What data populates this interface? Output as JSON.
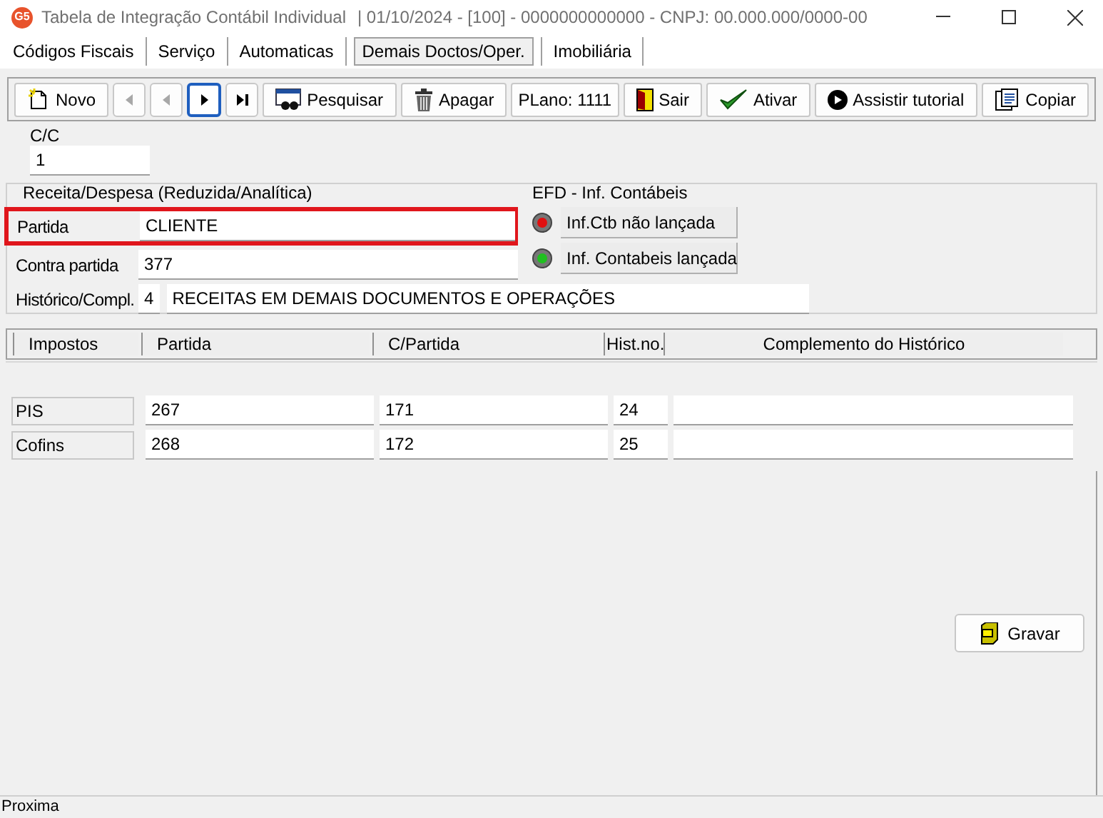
{
  "window": {
    "app_badge": "G5",
    "title": "Tabela de Integração Contábil Individual",
    "subtitle": "|  01/10/2024 - [100] - 0000000000000 - CNPJ: 00.000.000/0000-00"
  },
  "tabs": [
    {
      "label": "Códigos Fiscais",
      "selected": false
    },
    {
      "label": "Serviço",
      "selected": false
    },
    {
      "label": "Automaticas",
      "selected": false
    },
    {
      "label": "Demais Doctos/Oper.",
      "selected": true
    },
    {
      "label": "Imobiliária",
      "selected": false
    }
  ],
  "toolbar": [
    {
      "kind": "button",
      "label": "Novo"
    },
    {
      "kind": "nav",
      "disabled": true,
      "focused": false
    },
    {
      "kind": "nav",
      "disabled": true,
      "focused": false
    },
    {
      "kind": "nav",
      "disabled": false,
      "focused": true
    },
    {
      "kind": "nav",
      "disabled": false,
      "focused": false
    },
    {
      "kind": "button",
      "label": "Pesquisar"
    },
    {
      "kind": "button",
      "label": "Apagar"
    },
    {
      "kind": "text",
      "label": "PLano: 1111"
    },
    {
      "kind": "button",
      "label": "Sair"
    },
    {
      "kind": "button",
      "label": "Ativar"
    },
    {
      "kind": "button",
      "label": "Assistir tutorial"
    },
    {
      "kind": "button",
      "label": "Copiar"
    }
  ],
  "cc": {
    "label": "C/C",
    "value": "1"
  },
  "receita_group": {
    "title": "Receita/Despesa (Reduzida/Analítica)",
    "fields": [
      {
        "label": "Partida",
        "value": "CLIENTE",
        "highlighted": true
      },
      {
        "label": "Contra partida",
        "value": "377",
        "highlighted": false
      },
      {
        "label": "Histórico/Compl.",
        "value": "4",
        "extra": "RECEITAS EM DEMAIS DOCUMENTOS E OPERAÇÕES",
        "highlighted": false
      }
    ]
  },
  "efd_group": {
    "title": "EFD - Inf. Contábeis",
    "indicators": [
      {
        "label": "Inf.Ctb não lançada",
        "color": "#e01010"
      },
      {
        "label": "Inf. Contabeis lançada",
        "color": "#20c020"
      }
    ]
  },
  "table": {
    "columns": [
      "Impostos",
      "Partida",
      "C/Partida",
      "Hist.no.",
      "Complemento do Histórico"
    ],
    "rows": [
      {
        "tax": "PIS",
        "partida": "267",
        "c_partida": "171",
        "hist": "24"
      },
      {
        "tax": "Cofins",
        "partida": "268",
        "c_partida": "172",
        "hist": "25"
      }
    ]
  },
  "save_button": {
    "label": "Gravar"
  },
  "status_bar": "Proxima"
}
